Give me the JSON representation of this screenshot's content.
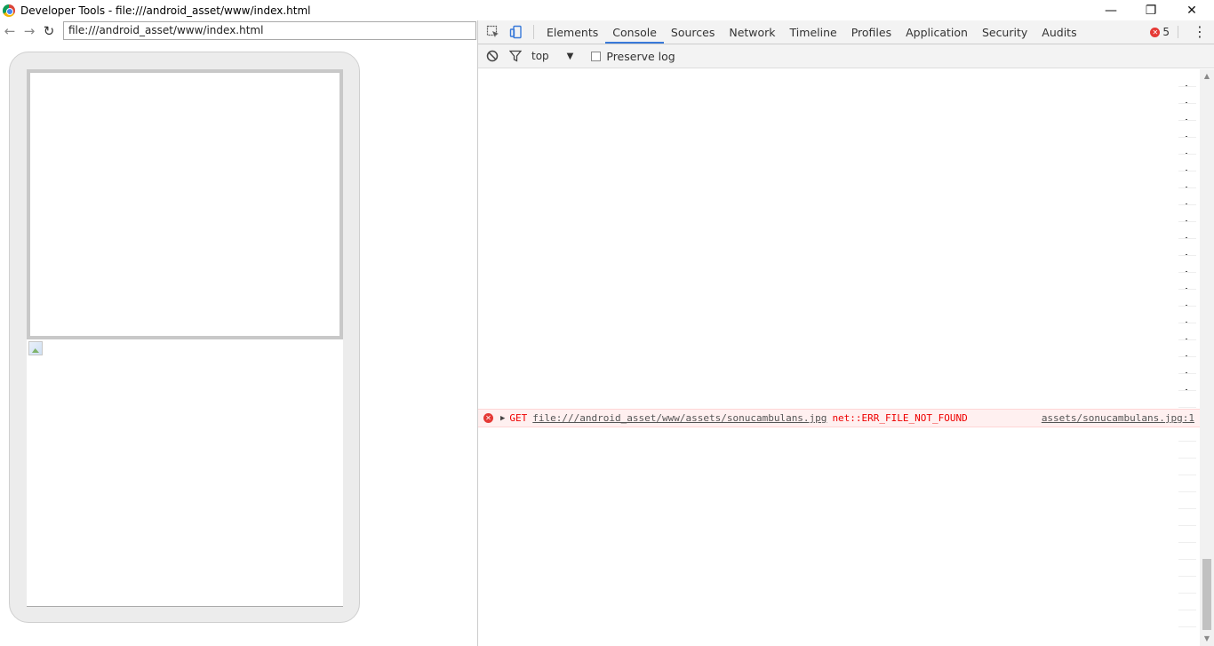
{
  "window": {
    "title": "Developer Tools - file:///android_asset/www/index.html",
    "controls": {
      "minimize": "—",
      "restore": "❐",
      "close": "✕"
    }
  },
  "browser": {
    "back_icon": "←",
    "forward_icon": "→",
    "reload_icon": "↻",
    "url": "file:///android_asset/www/index.html"
  },
  "devtools": {
    "tabs": [
      "Elements",
      "Console",
      "Sources",
      "Network",
      "Timeline",
      "Profiles",
      "Application",
      "Security",
      "Audits"
    ],
    "active_tab": "Console",
    "error_count": "5",
    "toolbar": {
      "context": "top",
      "preserve_log_label": "Preserve log",
      "preserve_log_checked": false
    },
    "messages": [
      {
        "level": "error",
        "method": "GET",
        "url": "file:///android_asset/www/assets/sonucambulans.jpg",
        "error": "net::ERR_FILE_NOT_FOUND",
        "source": "assets/sonucambulans.jpg:1"
      }
    ]
  },
  "colors": {
    "accent": "#3879d9",
    "error": "#e53935",
    "error_row_bg": "#fff0f0"
  }
}
